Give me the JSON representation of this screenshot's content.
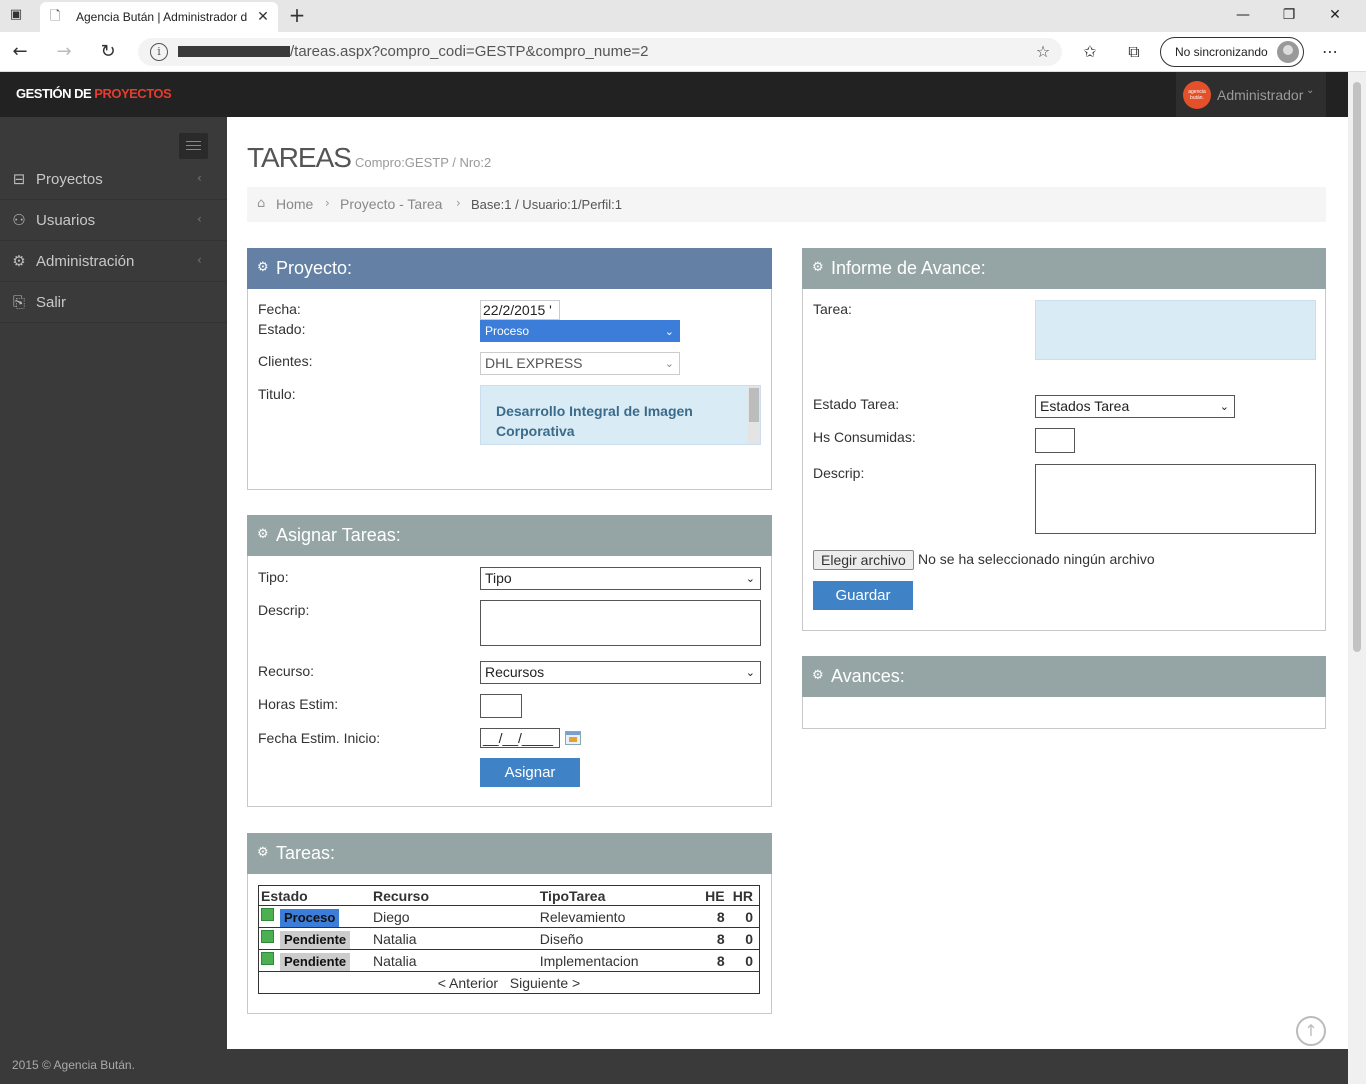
{
  "browser": {
    "tab_title": "Agencia Bután | Administrador d",
    "url": "/tareas.aspx?compro_codi=GESTP&compro_nume=2",
    "sync_label": "No sincronizando"
  },
  "app": {
    "brand_a": "GESTIÓN DE ",
    "brand_b": "PROYECTOS",
    "user_name": "Administrador",
    "user_logo_text": "agencia bután."
  },
  "sidebar": {
    "items": [
      {
        "label": "Proyectos"
      },
      {
        "label": "Usuarios"
      },
      {
        "label": "Administración"
      },
      {
        "label": "Salir"
      }
    ]
  },
  "page": {
    "title": "TAREAS",
    "subtitle": "Compro:GESTP / Nro:2",
    "breadcrumb": {
      "home": "Home",
      "item": "Proyecto - Tarea",
      "meta": "Base:1 / Usuario:1/Perfil:1"
    }
  },
  "proyecto": {
    "title": "Proyecto:",
    "fecha_label": "Fecha:",
    "fecha_value": "22/2/2015 '",
    "estado_label": "Estado:",
    "estado_value": "Proceso",
    "clientes_label": "Clientes:",
    "clientes_value": "DHL EXPRESS",
    "titulo_label": "Titulo:",
    "titulo_value": "Desarrollo Integral de Imagen Corporativa"
  },
  "asignar": {
    "title": "Asignar Tareas:",
    "tipo_label": "Tipo:",
    "tipo_value": "Tipo",
    "descrip_label": "Descrip:",
    "recurso_label": "Recurso:",
    "recurso_value": "Recursos",
    "horas_label": "Horas Estim:",
    "fecha_label": "Fecha Estim. Inicio:",
    "fecha_mask": "__/__/____",
    "button": "Asignar"
  },
  "tareas": {
    "title": "Tareas:",
    "headers": [
      "Estado",
      "Recurso",
      "TipoTarea",
      "HE",
      "HR"
    ],
    "rows": [
      {
        "estado": "Proceso",
        "recurso": "Diego",
        "tipo": "Relevamiento",
        "he": "8",
        "hr": "0"
      },
      {
        "estado": "Pendiente",
        "recurso": "Natalia",
        "tipo": "Diseño",
        "he": "8",
        "hr": "0"
      },
      {
        "estado": "Pendiente",
        "recurso": "Natalia",
        "tipo": "Implementacion",
        "he": "8",
        "hr": "0"
      }
    ],
    "prev": "< Anterior",
    "next": "Siguiente >"
  },
  "informe": {
    "title": "Informe de Avance:",
    "tarea_label": "Tarea:",
    "estado_label": "Estado Tarea:",
    "estado_value": "Estados Tarea",
    "hs_label": "Hs Consumidas:",
    "descrip_label": "Descrip:",
    "file_button": "Elegir archivo",
    "file_text": "No se ha seleccionado ningún archivo",
    "save_button": "Guardar"
  },
  "avances": {
    "title": "Avances:"
  },
  "footer": {
    "text": "2015 © Agencia Bután."
  }
}
